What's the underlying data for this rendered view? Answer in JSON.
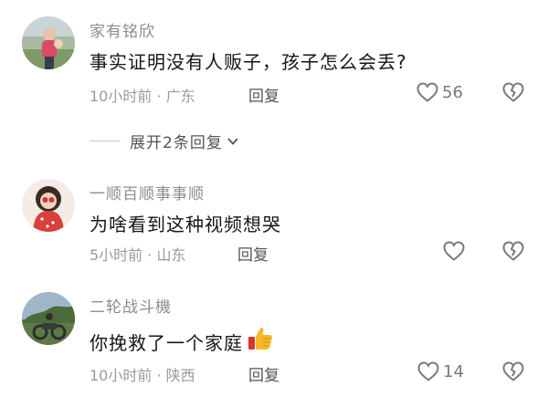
{
  "comments": [
    {
      "username": "家有铭欣",
      "text": "事实证明没有人贩子，孩子怎么会丢?",
      "time_location": "10小时前 · 广东",
      "reply_label": "回复",
      "likes": "56"
    },
    {
      "username": "一顺百顺事事顺",
      "text": "为啥看到这种视频想哭",
      "time_location": "5小时前 · 山东",
      "reply_label": "回复",
      "likes": ""
    },
    {
      "username": "二轮战斗機",
      "text": "你挽救了一个家庭",
      "time_location": "10小时前 · 陕西",
      "reply_label": "回复",
      "likes": "14"
    }
  ],
  "expand_replies": {
    "label": "展开2条回复"
  },
  "icons": {
    "like": "heart-outline-icon",
    "dislike": "broken-heart-icon",
    "expand": "chevron-down-icon",
    "emoji": "thumbs-up-emoji"
  },
  "colors": {
    "username": "#8c8c8c",
    "text": "#161616",
    "meta": "#9a9a9a",
    "icon": "#7a7a7a"
  }
}
